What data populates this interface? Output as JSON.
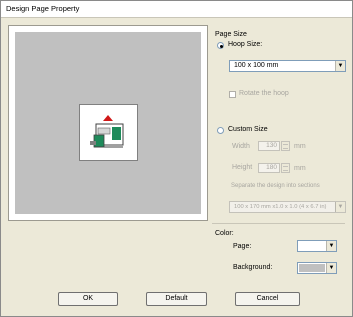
{
  "window": {
    "title": "Design Page Property"
  },
  "page_size": {
    "group_label": "Page Size",
    "hoop_size_label": "Hoop Size:",
    "hoop_size_value": "100 x 100 mm",
    "rotate_label": "Rotate the hoop",
    "custom_size_label": "Custom Size",
    "width_label": "Width",
    "width_value": "130",
    "height_label": "Height",
    "height_value": "180",
    "unit": "mm",
    "sections_label": "Separate the design into sections",
    "sections_value": "100 x 170 mm x1.0 x 1.0 (4 x 6.7 in)"
  },
  "color": {
    "group_label": "Color:",
    "page_label": "Page:",
    "page_color": "#ffffff",
    "background_label": "Background:",
    "background_color": "#c0c0c0"
  },
  "buttons": {
    "ok": "OK",
    "default": "Default",
    "cancel": "Cancel"
  },
  "icons": {
    "dropdown": "▼",
    "hoop_marker": "▲",
    "preview_icon": "embroidery-machine-icon"
  },
  "colors": {
    "accent_red": "#d01818",
    "machine_green": "#1e8a5a"
  }
}
